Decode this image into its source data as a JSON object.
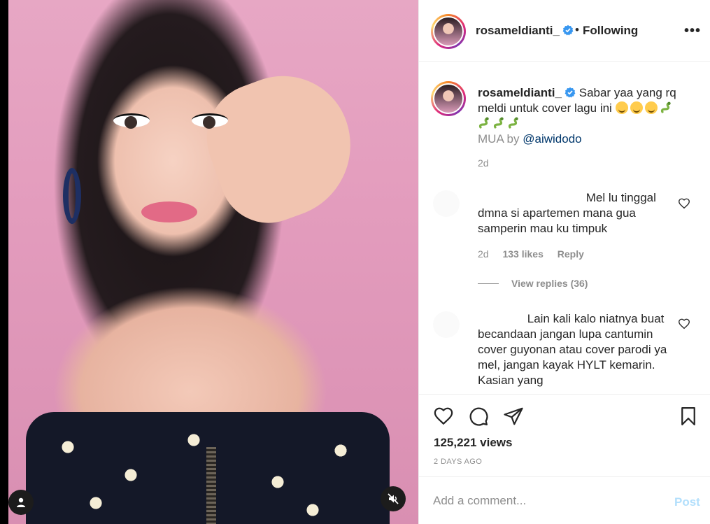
{
  "post": {
    "username": "rosameldianti_",
    "follow_separator": "•",
    "follow_status": "Following",
    "more_label": "•••"
  },
  "caption": {
    "username": "rosameldianti_",
    "text_line": "Sabar yaa yang rq meldi untuk cover lagu ini",
    "emoji_row1": [
      "smiling-face",
      "smiling-face",
      "smiling-face",
      "snake"
    ],
    "emoji_row2": [
      "snake",
      "snake",
      "snake"
    ],
    "mua_prefix": "MUA by",
    "mention": "@aiwidodo",
    "time": "2d"
  },
  "comments": [
    {
      "text": "Mel lu tinggal dmna si apartemen mana gua samperin mau ku timpuk",
      "time": "2d",
      "likes": "133 likes",
      "reply_label": "Reply",
      "view_replies": "View replies (36)"
    },
    {
      "text": "Lain kali kalo niatnya buat becandaan jangan lupa cantumin cover guyonan atau cover parodi ya mel, jangan kayak HYLT kemarin. Kasian yang"
    }
  ],
  "stats": {
    "views": "125,221 views",
    "date": "2 DAYS AGO"
  },
  "add_comment": {
    "placeholder": "Add a comment...",
    "post_label": "Post"
  },
  "colors": {
    "verified": "#3897f0",
    "post_disabled": "#b2dffc",
    "secondary_text": "#8e8e8e"
  }
}
